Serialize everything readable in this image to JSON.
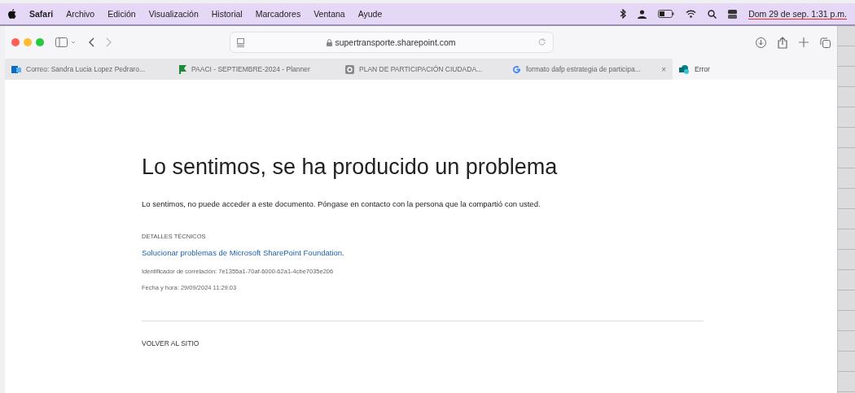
{
  "menu_bar": {
    "app": "Safari",
    "items": [
      "Archivo",
      "Edición",
      "Visualización",
      "Historial",
      "Marcadores",
      "Ventana",
      "Ayude"
    ],
    "clock": "Dom 29 de sep.  1:31 p.m."
  },
  "toolbar": {
    "address": "supertransporte.sharepoint.com"
  },
  "tabs": [
    {
      "label": "Correo: Sandra Lucia Lopez Pedraro...",
      "selected": false,
      "kind": "mail"
    },
    {
      "label": "PAACI - SEPTIEMBRE-2024 - Planner",
      "selected": false,
      "kind": "flag"
    },
    {
      "label": "PLAN DE PARTICIPACIÓN CIUDADA...",
      "selected": false,
      "kind": "document"
    },
    {
      "label": "formato dafp estrategia de participa...",
      "selected": false,
      "kind": "search",
      "close": "×"
    },
    {
      "label": "Error",
      "selected": true,
      "kind": "site"
    }
  ],
  "page": {
    "heading": "Lo sentimos, se ha producido un problema",
    "message": "Lo sentimos, no puede acceder a este documento. Póngase en contacto con la persona que la compartió con usted.",
    "details_label": "DETALLES TÉCNICOS",
    "help_link": "Solucionar problemas de Microsoft SharePoint Foundation.",
    "correlation": "Identificador de correlación: 7e1355a1-70af-6000-62a1-4cbe7035e206",
    "datetime": "Fecha y hora: 29/09/2024 11:29:03",
    "back_link": "VOLVER AL SITIO"
  }
}
